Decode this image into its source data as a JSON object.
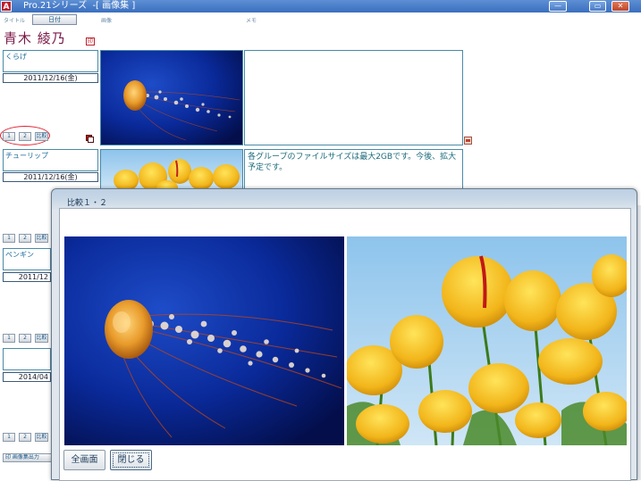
{
  "window": {
    "app_icon": "A",
    "title": "Pro.21シリーズ  -[ 画像集 ]",
    "buttons": {
      "minimize": "—",
      "restore": "▭",
      "close": "✕"
    }
  },
  "header": {
    "title_label": "タイトル",
    "date_label": "日付",
    "image_label": "画像",
    "memo_label": "メモ",
    "owner_name": "青木 綾乃",
    "stamp_icon": "印"
  },
  "records": [
    {
      "title": "くらげ",
      "date": "2011/12/16(金)",
      "memo": "",
      "image": "jellyfish-image"
    },
    {
      "title": "チューリップ",
      "date": "2011/12/16(金)",
      "memo": "各グループのファイルサイズは最大2GBです。今後、拡大予定です。",
      "image": "tulip-image"
    },
    {
      "title": "ペンギン",
      "date": "2011/12",
      "memo": "",
      "image": ""
    },
    {
      "title": "",
      "date": "2014/04",
      "memo": "",
      "image": ""
    }
  ],
  "row_buttons": {
    "one": "1",
    "two": "2",
    "compare": "比較"
  },
  "bottom_button": "印 画像集出力",
  "dialog": {
    "title": "比較１・２",
    "buttons": {
      "fullscreen": "全画面",
      "close": "閉じる"
    }
  },
  "colors": {
    "titlebar": "#3a6fbf",
    "owner_name": "#7a1a4a",
    "accent_border": "#4a8aa8",
    "highlight_oval": "#e02030"
  }
}
